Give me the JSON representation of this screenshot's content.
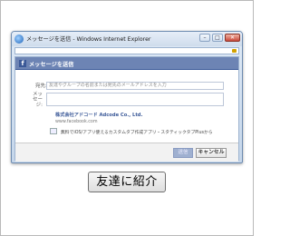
{
  "window": {
    "title": "メッセージを送信 - Windows Internet Explorer"
  },
  "dialog": {
    "header_title": "メッセージを送信",
    "fb_logo": "f",
    "to_label": "宛先:",
    "to_placeholder": "友達やグループの名前または宛先のメールアドレスを入力",
    "message_label": "メッセージ:",
    "attachment": {
      "title": "株式会社アドコード Adcode Co., Ltd.",
      "url": "www.facebook.com",
      "note": "無料でiOS/アプリ使えるカスタムタブ作成アプリ・スタティックタブPlusから"
    },
    "share_button": "送信",
    "cancel_button": "キャンセル"
  },
  "page": {
    "invite_button": "友達に紹介"
  }
}
